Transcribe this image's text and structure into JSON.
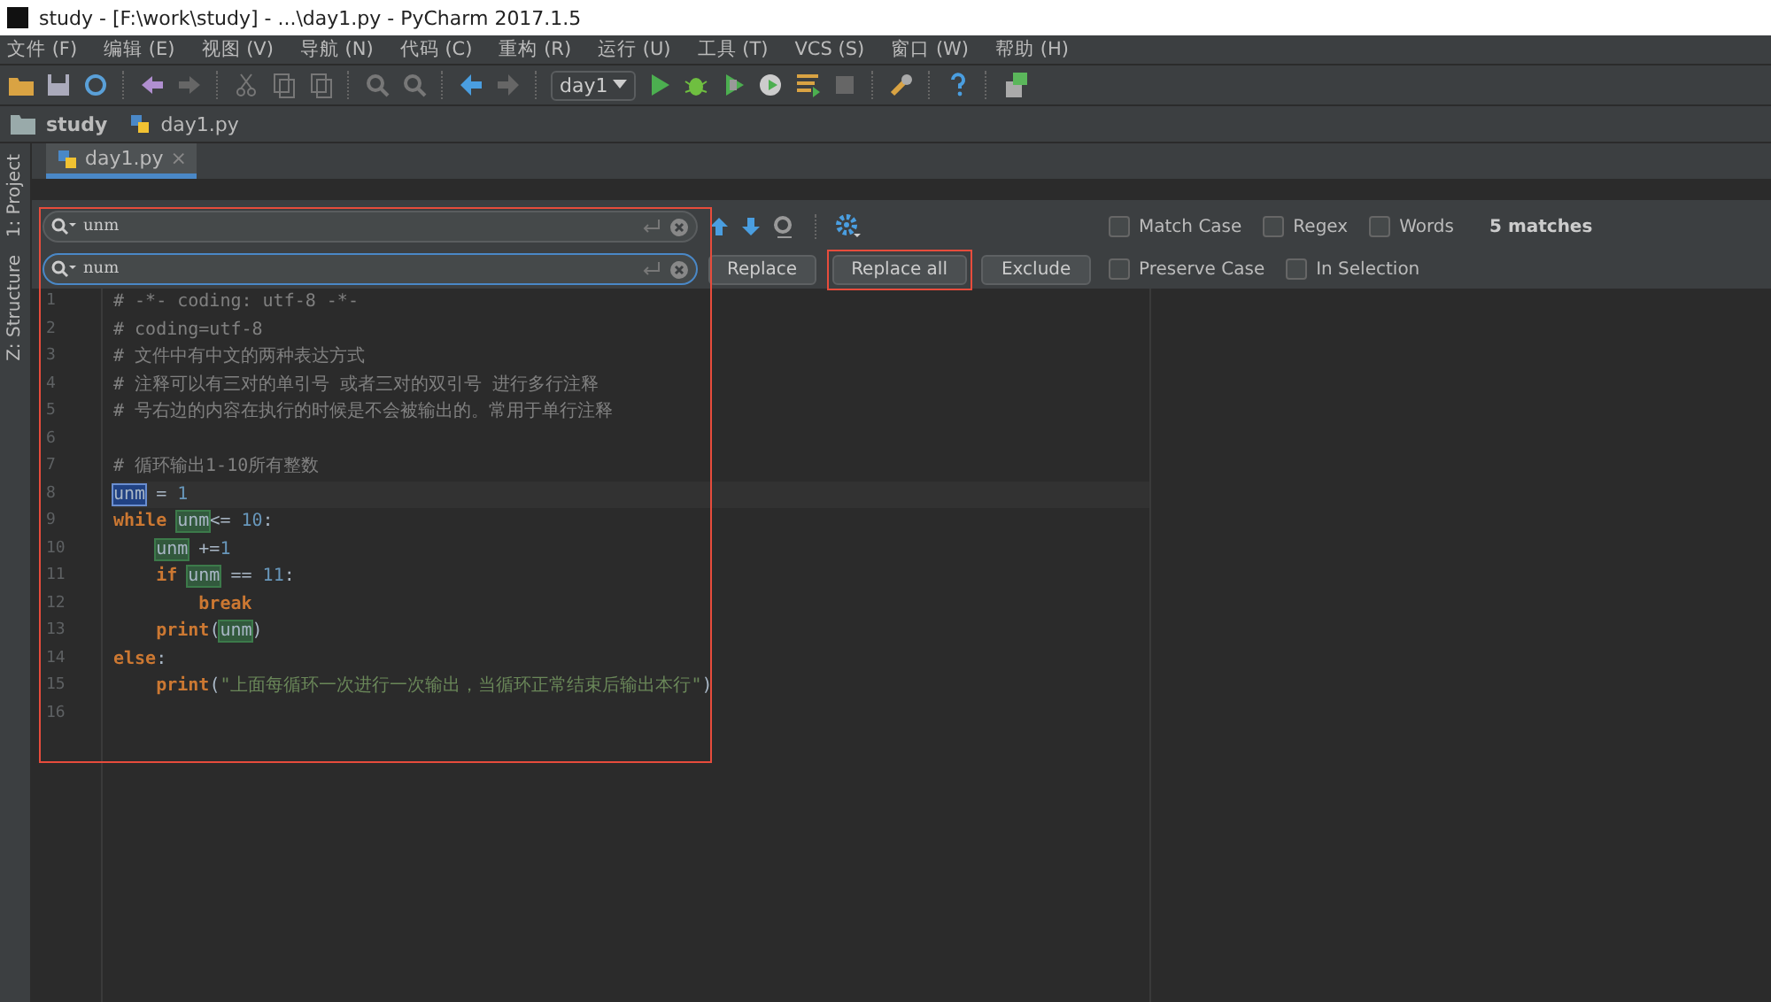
{
  "window": {
    "title": "study - [F:\\work\\study] - ...\\day1.py - PyCharm 2017.1.5"
  },
  "menu": [
    "文件 (F)",
    "编辑 (E)",
    "视图 (V)",
    "导航 (N)",
    "代码 (C)",
    "重构 (R)",
    "运行 (U)",
    "工具 (T)",
    "VCS (S)",
    "窗口 (W)",
    "帮助 (H)"
  ],
  "toolbar": {
    "run_config": "day1"
  },
  "breadcrumb": [
    "study",
    "day1.py"
  ],
  "side_tabs": [
    "1: Project",
    "Z: Structure"
  ],
  "tabs": [
    {
      "label": "day1.py",
      "selected": true,
      "close": "×"
    }
  ],
  "find_bar": {
    "highlighted": true,
    "search": "unm",
    "replace": "num",
    "buttons": [
      {
        "label": "Replace",
        "highlighted": false
      },
      {
        "label": "Replace all",
        "highlighted": true
      },
      {
        "label": "Exclude",
        "highlighted": false
      }
    ],
    "option_rows": [
      [
        {
          "label": "Match Case",
          "checked": false
        },
        {
          "label": "Regex",
          "checked": false
        },
        {
          "label": "Words",
          "checked": false
        }
      ],
      [
        {
          "label": "Preserve Case",
          "checked": false
        },
        {
          "label": "In Selection",
          "checked": false
        }
      ]
    ],
    "matches": "5 matches"
  },
  "code": [
    {
      "n": "1",
      "tokens": [
        {
          "kind": "comment",
          "text": "# -*- coding: utf-8 -*-"
        }
      ]
    },
    {
      "n": "2",
      "tokens": [
        {
          "kind": "comment",
          "text": "# coding=utf-8"
        }
      ]
    },
    {
      "n": "3",
      "tokens": [
        {
          "kind": "comment",
          "text": "# 文件中有中文的两种表达方式"
        }
      ]
    },
    {
      "n": "4",
      "tokens": [
        {
          "kind": "comment",
          "text": "# 注释可以有三对的单引号 或者三对的双引号 进行多行注释"
        }
      ]
    },
    {
      "n": "5",
      "tokens": [
        {
          "kind": "comment",
          "text": "# 号右边的内容在执行的时候是不会被输出的。常用于单行注释"
        }
      ]
    },
    {
      "n": "6"
    },
    {
      "n": "7",
      "tokens": [
        {
          "kind": "comment",
          "text": "# 循环输出1-10所有整数"
        }
      ]
    },
    {
      "n": "8",
      "tokens": [
        {
          "kind": "match",
          "text": "unm",
          "selected": true
        },
        {
          "kind": "plain",
          "text": " = "
        },
        {
          "kind": "number",
          "text": "1"
        }
      ]
    },
    {
      "n": "9",
      "tokens": [
        {
          "kind": "keyword",
          "text": "while "
        },
        {
          "kind": "match",
          "text": "unm",
          "selected": false
        },
        {
          "kind": "plain",
          "text": "<= "
        },
        {
          "kind": "number",
          "text": "10"
        },
        {
          "kind": "plain",
          "text": ":"
        }
      ],
      "children": [
        {
          "n": "10",
          "tokens": [
            {
              "kind": "match",
              "text": "unm",
              "selected": false
            },
            {
              "kind": "plain",
              "text": " +="
            },
            {
              "kind": "number",
              "text": "1"
            }
          ]
        },
        {
          "n": "11",
          "tokens": [
            {
              "kind": "keyword",
              "text": "if "
            },
            {
              "kind": "match",
              "text": "unm",
              "selected": false
            },
            {
              "kind": "plain",
              "text": " == "
            },
            {
              "kind": "number",
              "text": "11"
            },
            {
              "kind": "plain",
              "text": ":"
            }
          ],
          "children": [
            {
              "n": "12",
              "tokens": [
                {
                  "kind": "keyword",
                  "text": "break"
                }
              ]
            }
          ]
        },
        {
          "n": "13",
          "tokens": [
            {
              "kind": "keyword",
              "text": "print"
            },
            {
              "kind": "plain",
              "text": "("
            },
            {
              "kind": "match",
              "text": "unm",
              "selected": false
            },
            {
              "kind": "plain",
              "text": ")"
            }
          ]
        }
      ]
    },
    {
      "n": "14",
      "tokens": [
        {
          "kind": "keyword",
          "text": "else"
        },
        {
          "kind": "plain",
          "text": ":"
        }
      ],
      "children": [
        {
          "n": "15",
          "tokens": [
            {
              "kind": "keyword",
              "text": "print"
            },
            {
              "kind": "plain",
              "text": "("
            },
            {
              "kind": "string",
              "text": "\"上面每循环一次进行一次输出，当循环正常结束后输出本行\""
            },
            {
              "kind": "plain",
              "text": ")"
            }
          ]
        }
      ]
    },
    {
      "n": "16"
    }
  ]
}
